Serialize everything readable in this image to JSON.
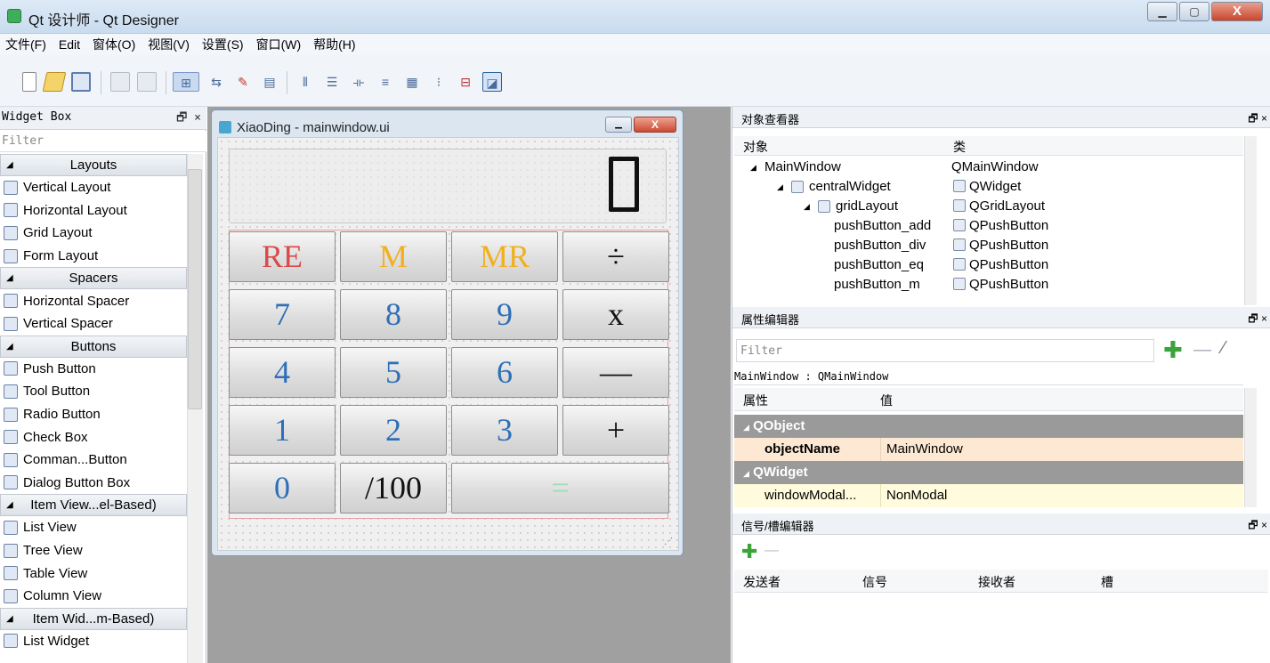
{
  "window": {
    "title": "Qt 设计师 - Qt Designer",
    "min": "▁",
    "max": "▢",
    "close": "X"
  },
  "menu": [
    "文件(F)",
    "Edit",
    "窗体(O)",
    "视图(V)",
    "设置(S)",
    "窗口(W)",
    "帮助(H)"
  ],
  "widget_box": {
    "title": "Widget Box",
    "controls": "🗗 ×",
    "filter_placeholder": "Filter",
    "items": [
      {
        "type": "cat",
        "label": "Layouts"
      },
      {
        "type": "item",
        "label": "Vertical Layout",
        "icon": "vertical-layout-icon"
      },
      {
        "type": "item",
        "label": "Horizontal Layout",
        "icon": "horizontal-layout-icon"
      },
      {
        "type": "item",
        "label": "Grid Layout",
        "icon": "grid-layout-icon"
      },
      {
        "type": "item",
        "label": "Form Layout",
        "icon": "form-layout-icon"
      },
      {
        "type": "cat",
        "label": "Spacers"
      },
      {
        "type": "item",
        "label": "Horizontal Spacer",
        "icon": "horizontal-spacer-icon"
      },
      {
        "type": "item",
        "label": "Vertical Spacer",
        "icon": "vertical-spacer-icon"
      },
      {
        "type": "cat",
        "label": "Buttons"
      },
      {
        "type": "item",
        "label": "Push Button",
        "icon": "push-button-icon"
      },
      {
        "type": "item",
        "label": "Tool Button",
        "icon": "tool-button-icon"
      },
      {
        "type": "item",
        "label": "Radio Button",
        "icon": "radio-button-icon"
      },
      {
        "type": "item",
        "label": "Check Box",
        "icon": "check-box-icon"
      },
      {
        "type": "item",
        "label": "Comman...Button",
        "icon": "command-button-icon"
      },
      {
        "type": "item",
        "label": "Dialog Button Box",
        "icon": "dialog-button-box-icon"
      },
      {
        "type": "cat",
        "label": "Item View...el-Based)"
      },
      {
        "type": "item",
        "label": "List View",
        "icon": "list-view-icon"
      },
      {
        "type": "item",
        "label": "Tree View",
        "icon": "tree-view-icon"
      },
      {
        "type": "item",
        "label": "Table View",
        "icon": "table-view-icon"
      },
      {
        "type": "item",
        "label": "Column View",
        "icon": "column-view-icon"
      },
      {
        "type": "cat",
        "label": "Item Wid...m-Based)"
      },
      {
        "type": "item",
        "label": "List Widget",
        "icon": "list-widget-icon"
      }
    ]
  },
  "form": {
    "title": "XiaoDing - mainwindow.ui",
    "display_value": "0",
    "buttons": [
      {
        "label": "RE",
        "color": "#d94a4a"
      },
      {
        "label": "M",
        "color": "#f0b020"
      },
      {
        "label": "MR",
        "color": "#f0b020"
      },
      {
        "label": "÷",
        "color": "#111111"
      },
      {
        "label": "7",
        "color": "#2f6fb8"
      },
      {
        "label": "8",
        "color": "#2f6fb8"
      },
      {
        "label": "9",
        "color": "#2f6fb8"
      },
      {
        "label": "x",
        "color": "#111111"
      },
      {
        "label": "4",
        "color": "#2f6fb8"
      },
      {
        "label": "5",
        "color": "#2f6fb8"
      },
      {
        "label": "6",
        "color": "#2f6fb8"
      },
      {
        "label": "—",
        "color": "#111111"
      },
      {
        "label": "1",
        "color": "#2f6fb8"
      },
      {
        "label": "2",
        "color": "#2f6fb8"
      },
      {
        "label": "3",
        "color": "#2f6fb8"
      },
      {
        "label": "+",
        "color": "#111111"
      },
      {
        "label": "0",
        "color": "#2f6fb8"
      },
      {
        "label": "/100",
        "color": "#111111"
      },
      {
        "label": "=",
        "color": "#9fdcb8"
      }
    ]
  },
  "object_inspector": {
    "title": "对象查看器",
    "col_object": "对象",
    "col_class": "类",
    "rows": [
      {
        "name": "MainWindow",
        "cls": "QMainWindow"
      },
      {
        "name": "centralWidget",
        "cls": "QWidget"
      },
      {
        "name": "gridLayout",
        "cls": "QGridLayout"
      },
      {
        "name": "pushButton_add",
        "cls": "QPushButton"
      },
      {
        "name": "pushButton_div",
        "cls": "QPushButton"
      },
      {
        "name": "pushButton_eq",
        "cls": "QPushButton"
      },
      {
        "name": "pushButton_m",
        "cls": "QPushButton"
      }
    ]
  },
  "property_editor": {
    "title": "属性编辑器",
    "filter_placeholder": "Filter",
    "context": "MainWindow : QMainWindow",
    "col_property": "属性",
    "col_value": "值",
    "group1": "QObject",
    "prop1": "objectName",
    "val1": "MainWindow",
    "group2": "QWidget",
    "prop2": "windowModal...",
    "val2": "NonModal"
  },
  "signal_slot_editor": {
    "title": "信号/槽编辑器",
    "col_sender": "发送者",
    "col_signal": "信号",
    "col_receiver": "接收者",
    "col_slot": "槽"
  }
}
